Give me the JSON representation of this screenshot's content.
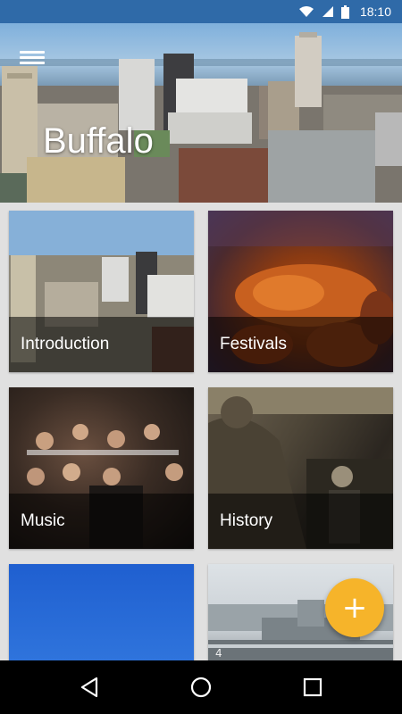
{
  "status_bar": {
    "time": "18:10",
    "icons": [
      "wifi-icon",
      "signal-icon",
      "battery-icon"
    ]
  },
  "header": {
    "title": "Buffalo",
    "menu_icon": "hamburger-menu-icon"
  },
  "cards": [
    {
      "label": "Introduction"
    },
    {
      "label": "Festivals"
    },
    {
      "label": "Music"
    },
    {
      "label": "History"
    },
    {
      "label": ""
    },
    {
      "label": ""
    }
  ],
  "fab": {
    "icon": "plus-icon",
    "color": "#f6b42a"
  },
  "nav_bar": {
    "icons": [
      "back-icon",
      "home-icon",
      "recents-icon"
    ]
  },
  "colors": {
    "status_bar": "#2f6aa8",
    "accent": "#f6b42a",
    "background": "#e0e0e0"
  }
}
